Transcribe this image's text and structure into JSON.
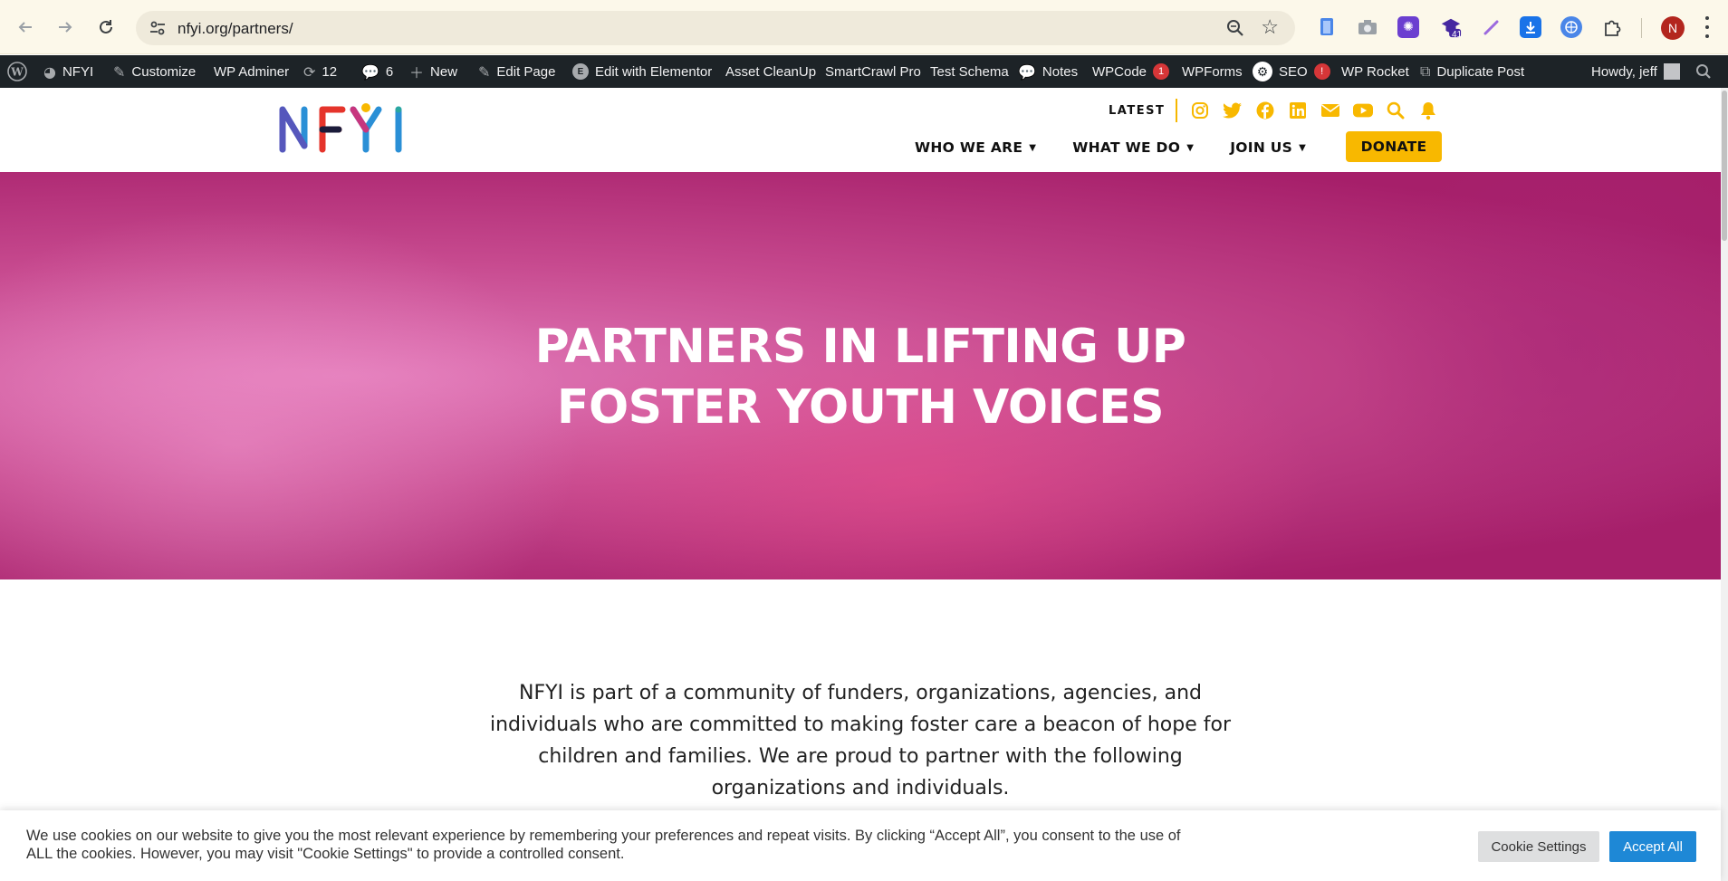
{
  "browser": {
    "url": "nfyi.org/partners/",
    "profile_initial": "N",
    "extension_badge": "41",
    "icons": [
      "back-icon",
      "forward-icon",
      "reload-icon",
      "site-settings-icon",
      "zoom-icon",
      "bookmark-star-icon",
      "extensions-puzzle-icon",
      "menu-kebab-icon"
    ]
  },
  "admin_bar": {
    "site_name": "NFYI",
    "customize": "Customize",
    "wp_adminer": "WP Adminer",
    "updates_count": "12",
    "comments_count": "6",
    "new": "New",
    "edit_page": "Edit Page",
    "edit_elementor": "Edit with Elementor",
    "asset_cleanup": "Asset CleanUp",
    "smartcrawl": "SmartCrawl Pro",
    "test_schema": "Test Schema",
    "notes": "Notes",
    "wpcode": "WPCode",
    "wpcode_badge": "1",
    "wpforms": "WPForms",
    "seo": "SEO",
    "seo_badge": "!",
    "wp_rocket": "WP Rocket",
    "duplicate_post": "Duplicate Post",
    "howdy": "Howdy, jeff"
  },
  "header": {
    "logo_text": "NFYI",
    "latest": "LATEST",
    "social_icons": [
      "instagram-icon",
      "twitter-icon",
      "facebook-icon",
      "linkedin-icon",
      "email-icon",
      "youtube-icon",
      "search-icon",
      "bell-icon"
    ],
    "nav": [
      {
        "label": "WHO WE ARE"
      },
      {
        "label": "WHAT WE DO"
      },
      {
        "label": "JOIN US"
      }
    ],
    "donate": "DONATE",
    "accent_color": "#f8b800"
  },
  "hero": {
    "line1": "PARTNERS IN LIFTING UP",
    "line2": "FOSTER YOUTH VOICES",
    "overlay_color": "#c4307a"
  },
  "intro": {
    "text": "NFYI is part of a community of funders, organizations, agencies, and individuals who are committed to making foster care a beacon of hope for children and families. We are proud to partner with the following organizations and individuals."
  },
  "cookie": {
    "message": "We use cookies on our website to give you the most relevant experience by remembering your preferences and repeat visits. By clicking “Accept All”, you consent to the use of ALL the cookies. However, you may visit \"Cookie Settings\" to provide a controlled consent.",
    "settings_button": "Cookie Settings",
    "accept_button": "Accept All",
    "accept_color": "#1e88d6"
  }
}
